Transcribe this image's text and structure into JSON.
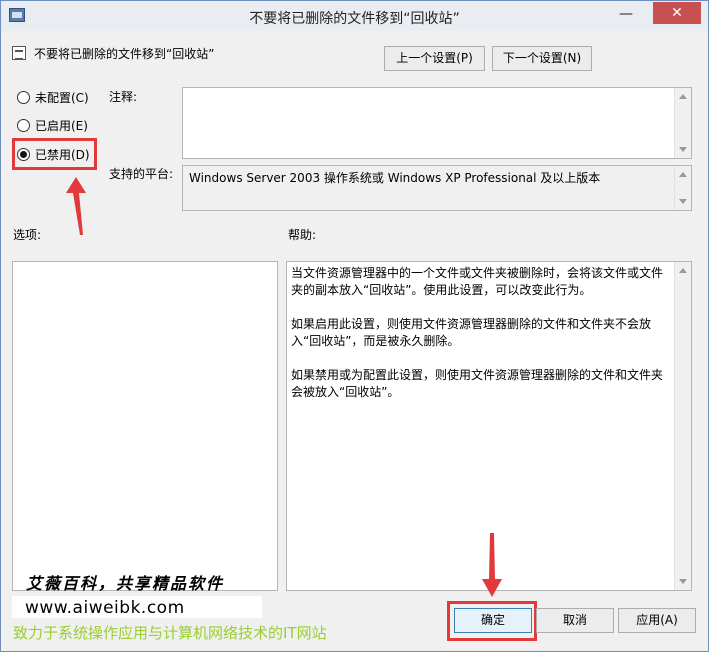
{
  "window": {
    "title": "不要将已删除的文件移到“回收站”",
    "minimize_glyph": "—",
    "close_glyph": "✕"
  },
  "policy": {
    "name": "不要将已删除的文件移到“回收站”",
    "prev_button": "上一个设置(P)",
    "next_button": "下一个设置(N)"
  },
  "state": {
    "options": [
      {
        "label": "未配置(C)",
        "selected": false
      },
      {
        "label": "已启用(E)",
        "selected": false
      },
      {
        "label": "已禁用(D)",
        "selected": true
      }
    ]
  },
  "fields": {
    "comment_label": "注释:",
    "comment_value": "",
    "platform_label": "支持的平台:",
    "platform_value": "Windows Server 2003 操作系统或 Windows XP Professional 及以上版本",
    "options_label": "选项:",
    "help_label": "帮助:"
  },
  "help": {
    "paragraphs": [
      "当文件资源管理器中的一个文件或文件夹被删除时，会将该文件或文件夹的副本放入“回收站”。使用此设置，可以改变此行为。",
      "如果启用此设置，则使用文件资源管理器删除的文件和文件夹不会放入“回收站”，而是被永久删除。",
      "如果禁用或为配置此设置，则使用文件资源管理器删除的文件和文件夹会被放入“回收站”。"
    ]
  },
  "footer": {
    "ok": "确定",
    "cancel": "取消",
    "apply": "应用(A)"
  },
  "watermark": {
    "line1": "艾薇百科，共享精品软件",
    "url": "www.aiweibk.com",
    "slogan": "致力于系统操作应用与计算机网络技术的IT网站"
  },
  "colors": {
    "highlight_red": "#e23a3a",
    "close_button": "#c75050",
    "slogan_green": "#9acd32"
  }
}
